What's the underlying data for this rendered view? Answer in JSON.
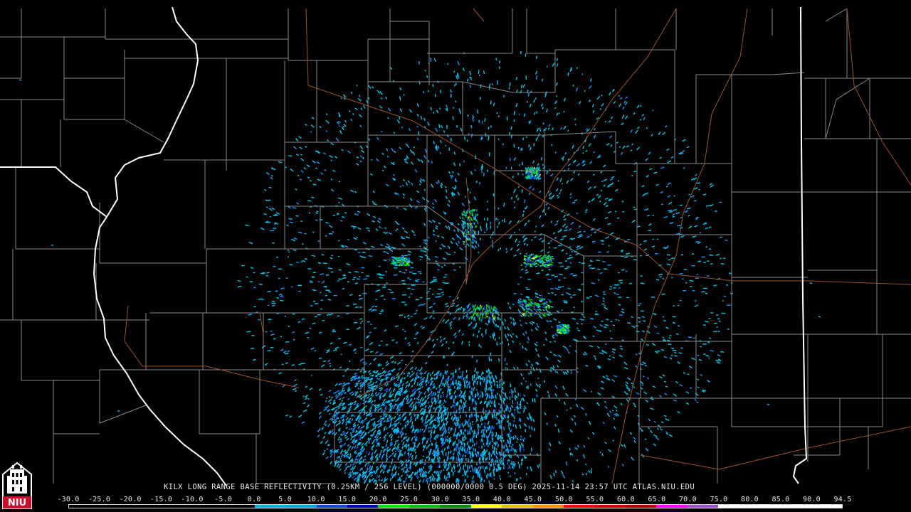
{
  "caption": "KILX LONG RANGE BASE REFLECTIVITY (0.25KM / 256 LEVEL) (000000/0000 0.5 DEG) 2025-11-14 23:57 UTC  ATLAS.NIU.EDU",
  "logo": {
    "name": "niu-logo",
    "text": "NIU"
  },
  "scale": {
    "labels": [
      "-30.0",
      "-25.0",
      "-20.0",
      "-15.0",
      "-10.0",
      "-5.0",
      "0.0",
      "5.0",
      "10.0",
      "15.0",
      "20.0",
      "25.0",
      "30.0",
      "35.0",
      "40.0",
      "45.0",
      "50.0",
      "55.0",
      "60.0",
      "65.0",
      "70.0",
      "75.0",
      "80.0",
      "85.0",
      "90.0",
      "94.5"
    ],
    "colors": [
      "#000000",
      "#000000",
      "#000000",
      "#000000",
      "#000000",
      "#000000",
      "#00b4e0",
      "#00a6d8",
      "#1446d0",
      "#0000b8",
      "#00e600",
      "#00c000",
      "#008a00",
      "#ffff00",
      "#e6c000",
      "#ff9000",
      "#ff0000",
      "#d00000",
      "#b00000",
      "#ff00ff",
      "#9a55c8",
      "#ffffff",
      "#ffffff",
      "#ffffff",
      "#ffffff"
    ]
  },
  "map_colors": {
    "background": "#000000",
    "county_lines": "#8a8a8a",
    "state_borders": "#ffffff",
    "highways": "#a0522d",
    "echo_light": "#00c8f0",
    "echo_medium": "#0f96ff",
    "echo_blue": "#1f3cd8",
    "echo_green": "#00e000",
    "echo_yellow": "#ffff00"
  }
}
